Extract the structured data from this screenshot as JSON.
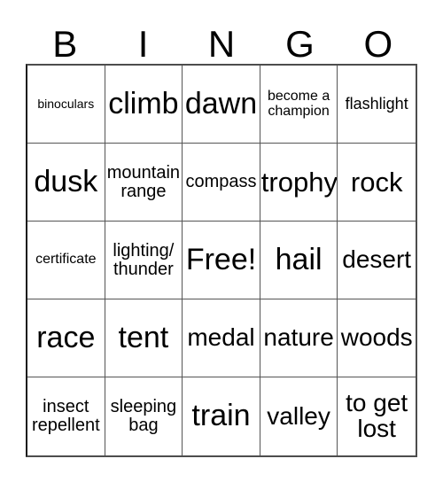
{
  "header": {
    "letters": [
      "B",
      "I",
      "N",
      "G",
      "O"
    ]
  },
  "grid": {
    "rows": [
      [
        {
          "label": "binoculars",
          "size": "t-xs"
        },
        {
          "label": "climb",
          "size": "t-max"
        },
        {
          "label": "dawn",
          "size": "t-max"
        },
        {
          "label": "become a\nchampion",
          "size": "t-sm"
        },
        {
          "label": "flashlight",
          "size": "t-smm"
        }
      ],
      [
        {
          "label": "dusk",
          "size": "t-max"
        },
        {
          "label": "mountain\nrange",
          "size": "t-md"
        },
        {
          "label": "compass",
          "size": "t-md"
        },
        {
          "label": "trophy",
          "size": "t-xxl"
        },
        {
          "label": "rock",
          "size": "t-xxl"
        }
      ],
      [
        {
          "label": "certificate",
          "size": "t-sm"
        },
        {
          "label": "lighting/\nthunder",
          "size": "t-md"
        },
        {
          "label": "Free!",
          "size": "t-max"
        },
        {
          "label": "hail",
          "size": "t-max"
        },
        {
          "label": "desert",
          "size": "t-xl"
        }
      ],
      [
        {
          "label": "race",
          "size": "t-max"
        },
        {
          "label": "tent",
          "size": "t-max"
        },
        {
          "label": "medal",
          "size": "t-xl"
        },
        {
          "label": "nature",
          "size": "t-xl"
        },
        {
          "label": "woods",
          "size": "t-xl"
        }
      ],
      [
        {
          "label": "insect\nrepellent",
          "size": "t-md"
        },
        {
          "label": "sleeping\nbag",
          "size": "t-md"
        },
        {
          "label": "train",
          "size": "t-max"
        },
        {
          "label": "valley",
          "size": "t-xl"
        },
        {
          "label": "to get\nlost",
          "size": "t-xl"
        }
      ]
    ]
  },
  "colors": {
    "background": "#ffffff",
    "text": "#000000",
    "grid_line": "#555555",
    "grid_border": "#1a1a1a"
  }
}
